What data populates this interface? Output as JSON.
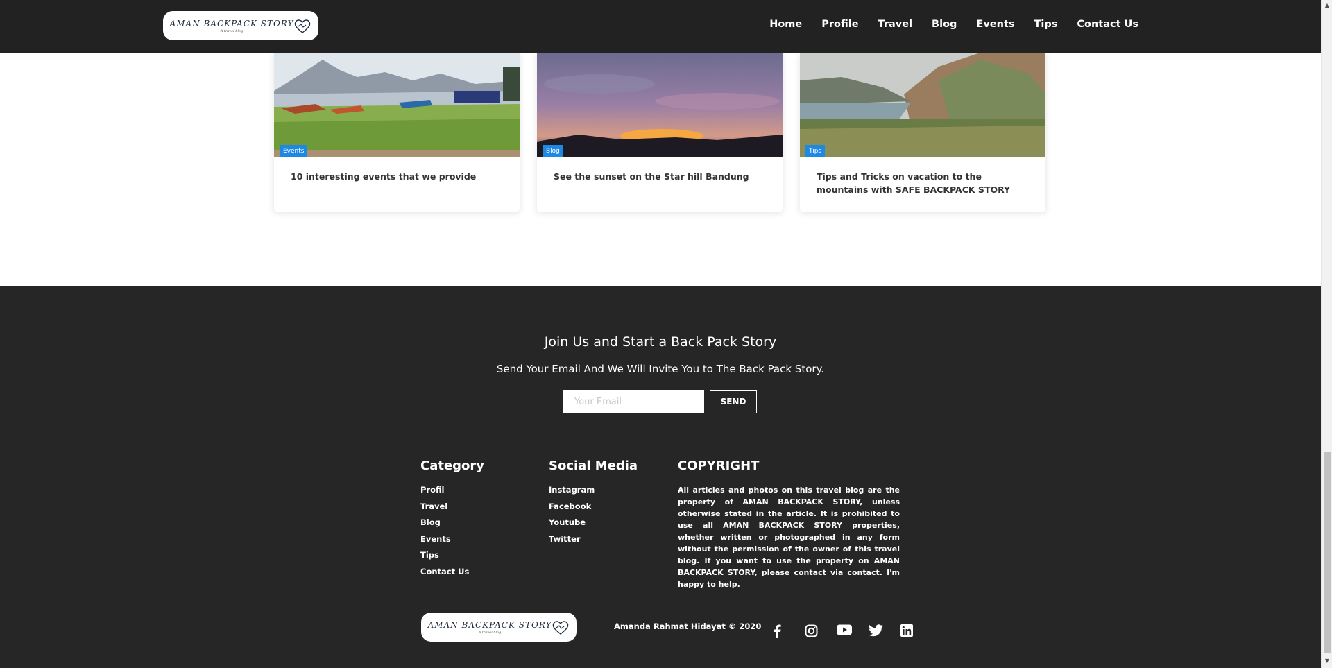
{
  "nav": {
    "logo_text": "AMAN BACKPACK STORY",
    "logo_sub": "A travel blog",
    "items": [
      "Home",
      "Profile",
      "Travel",
      "Blog",
      "Events",
      "Tips",
      "Contact Us"
    ]
  },
  "cards": [
    {
      "badge": "Events",
      "title": "10 interesting events that we provide"
    },
    {
      "badge": "Blog",
      "title": "See the sunset on the Star hill Bandung"
    },
    {
      "badge": "Tips",
      "title": "Tips and Tricks on vacation to the mountains with SAFE BACKPACK STORY"
    }
  ],
  "footer": {
    "join_title": "Join Us and Start a Back Pack Story",
    "join_sub": "Send Your Email And We Will Invite You to The Back Pack Story.",
    "email_placeholder": "Your Email",
    "send_label": "SEND",
    "category_heading": "Category",
    "category_items": [
      "Profil",
      "Travel",
      "Blog",
      "Events",
      "Tips",
      "Contact Us"
    ],
    "social_heading": "Social Media",
    "social_items": [
      "Instagram",
      "Facebook",
      "Youtube",
      "Twitter"
    ],
    "copyright_heading": "COPYRIGHT",
    "copyright_text": "All articles and photos on this travel blog are the property of AMAN BACKPACK STORY, unless otherwise stated in the article. It is prohibited to use all AMAN BACKPACK STORY properties, whether written or photographed in any form without the permission of the owner of this travel blog. If you want to use the property on AMAN BACKPACK STORY, please contact via contact. I'm happy to help.",
    "logo_text": "AMAN BACKPACK STORY",
    "logo_sub": "A travel blog",
    "credit": "Amanda Rahmat Hidayat © 2020",
    "social_icons": [
      "facebook-icon",
      "instagram-icon",
      "youtube-icon",
      "twitter-icon",
      "linkedin-icon"
    ]
  },
  "colors": {
    "navbar_bg": "#222222",
    "footer_bg": "#262626",
    "badge_blue": "#1e88e5"
  }
}
